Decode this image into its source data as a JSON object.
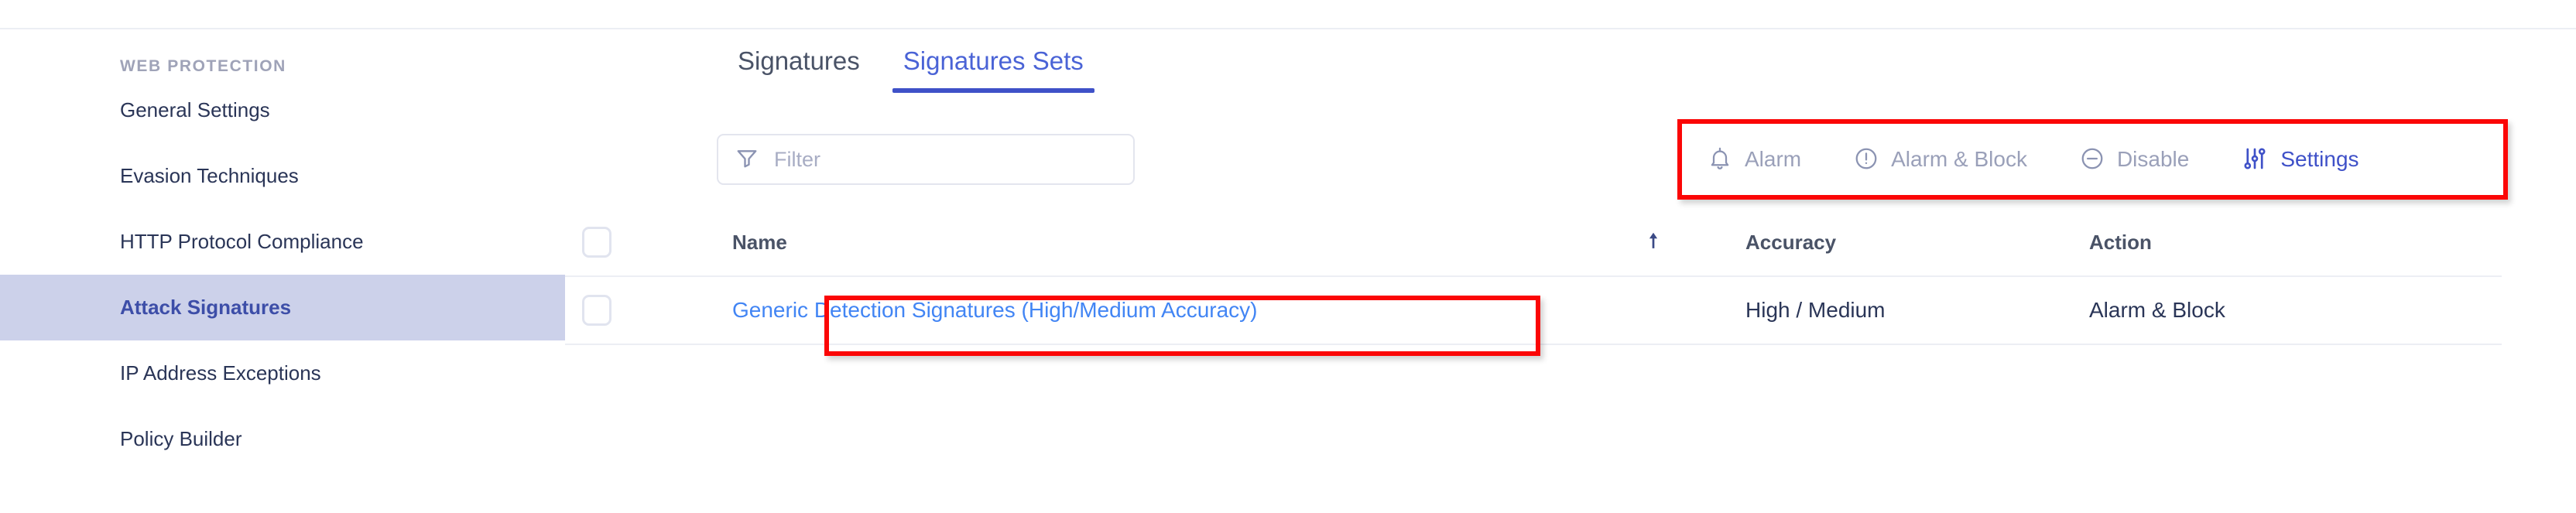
{
  "sidebar": {
    "heading": "WEB PROTECTION",
    "items": [
      {
        "label": "General Settings",
        "active": false
      },
      {
        "label": "Evasion Techniques",
        "active": false
      },
      {
        "label": "HTTP Protocol Compliance",
        "active": false
      },
      {
        "label": "Attack Signatures",
        "active": true
      },
      {
        "label": "IP Address Exceptions",
        "active": false
      },
      {
        "label": "Policy Builder",
        "active": false
      }
    ]
  },
  "tabs": [
    {
      "label": "Signatures",
      "active": false
    },
    {
      "label": "Signatures Sets",
      "active": true
    }
  ],
  "filter": {
    "placeholder": "Filter",
    "value": "",
    "icon": "funnel-icon"
  },
  "toolbar": {
    "actions": [
      {
        "label": "Alarm",
        "icon": "bell-icon",
        "state": "disabled"
      },
      {
        "label": "Alarm & Block",
        "icon": "exclamation-circle-icon",
        "state": "disabled"
      },
      {
        "label": "Disable",
        "icon": "minus-circle-icon",
        "state": "disabled"
      },
      {
        "label": "Settings",
        "icon": "sliders-icon",
        "state": "enabled"
      }
    ]
  },
  "table": {
    "columns": {
      "name": "Name",
      "accuracy": "Accuracy",
      "action": "Action"
    },
    "sort": {
      "column": "accuracy",
      "direction": "asc",
      "icon": "sort-arrow-up-icon"
    },
    "rows": [
      {
        "selected": false,
        "name": "Generic Detection Signatures (High/Medium Accuracy)",
        "accuracy": "High / Medium",
        "action": "Alarm & Block"
      }
    ]
  },
  "annotations": [
    {
      "name": "toolbar-highlight",
      "color": "#fb0606"
    },
    {
      "name": "signature-set-row-highlight",
      "color": "#fb0606"
    }
  ],
  "colors": {
    "accent": "#3f51c8",
    "link": "#4285f4",
    "active_nav_bg": "#ccd1ea",
    "annotation": "#fb0606",
    "muted_text": "#9aa0b9",
    "border": "#eceef4"
  }
}
